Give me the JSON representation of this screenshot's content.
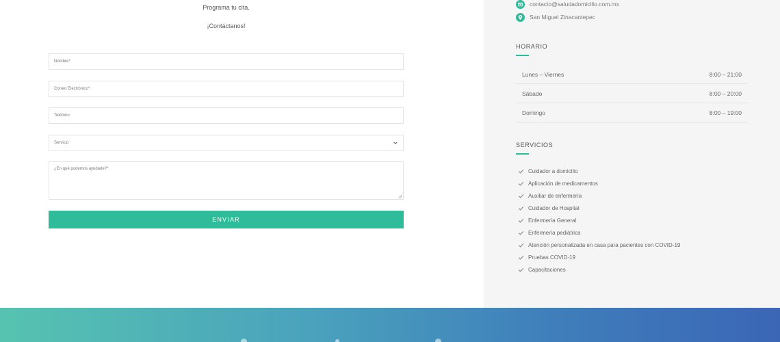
{
  "intro": {
    "line1": "Programa tu cita.",
    "line2": "¡Contáctanos!"
  },
  "form": {
    "name_placeholder": "Nombre*",
    "email_placeholder": "Correo Electrónico*",
    "phone_placeholder": "Teléfono",
    "service_selected": "Servicio",
    "message_placeholder": "¿En qué podemos ayudarle?*",
    "submit_label": "ENVIAR"
  },
  "contact": {
    "email": "contacto@saludadomicilio.com.mx",
    "location": "San Miguel Zinacantepec"
  },
  "schedule": {
    "title": "HORARIO",
    "rows": [
      {
        "day": "Lunes – Viernes",
        "hours": "8:00 – 21:00"
      },
      {
        "day": "Sábado",
        "hours": "8:00 – 20:00"
      },
      {
        "day": "Domingo",
        "hours": "8:00 – 19:00"
      }
    ]
  },
  "services": {
    "title": "SERVICIOS",
    "items": [
      "Cuidador a domicilio",
      "Aplicación de medicamentos",
      "Auxiliar de enfermería",
      "Cuidador de Hospital",
      "Enfermería General",
      "Enfermería pediátrica",
      "Atención personalizada en casa para pacientes con COVID-19",
      "Pruebas COVID-19",
      "Capacitaciones"
    ]
  },
  "colors": {
    "accent": "#2ebc9b",
    "footer_start": "#56c3b0",
    "footer_end": "#3b66b6",
    "sidebar_bg": "#f5f5f5"
  },
  "icons": {
    "email": "envelope-icon",
    "location": "map-pin-icon",
    "service_item": "check-icon",
    "select": "chevron-down-icon"
  }
}
